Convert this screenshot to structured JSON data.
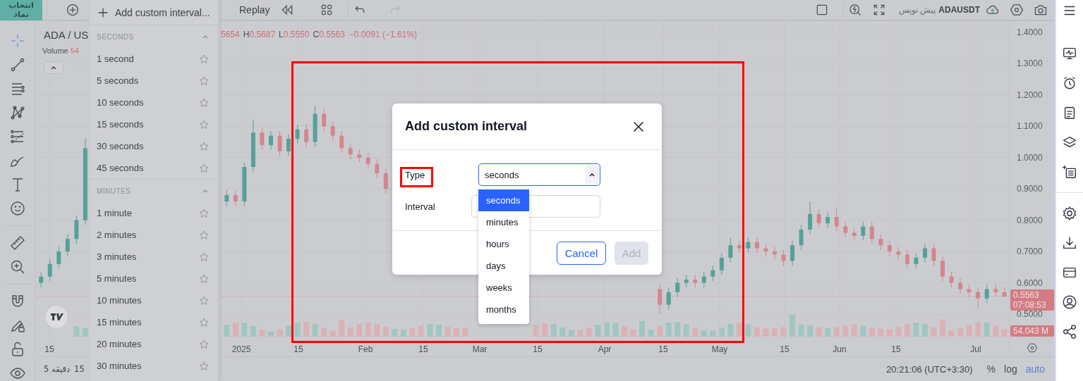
{
  "top_bar": {
    "symbol_button": "انتخاب نماد",
    "replay": "Replay",
    "symbol": "ADAUSDT",
    "draft_label": "پیش نویس"
  },
  "tools": [
    {
      "selected": true
    },
    {
      "selected": false
    },
    {
      "selected": false
    },
    {
      "selected": false
    },
    {
      "selected": false
    },
    {
      "selected": false
    },
    {
      "selected": false
    },
    {
      "selected": false
    },
    {
      "selected": false
    },
    {
      "selected": false
    },
    {
      "selected": false
    },
    {
      "selected": false
    },
    {
      "selected": false
    },
    {
      "selected": false
    }
  ],
  "interval_menu": {
    "add_custom": "Add custom interval...",
    "sections": [
      {
        "title": "SECONDS",
        "expanded": true,
        "items": [
          {
            "label": "1 second",
            "favorite": false
          },
          {
            "label": "5 seconds",
            "favorite": false
          },
          {
            "label": "10 seconds",
            "favorite": false
          },
          {
            "label": "15 seconds",
            "favorite": false
          },
          {
            "label": "30 seconds",
            "favorite": false
          },
          {
            "label": "45 seconds",
            "favorite": false
          }
        ]
      },
      {
        "title": "MINUTES",
        "expanded": true,
        "items": [
          {
            "label": "1 minute",
            "favorite": false
          },
          {
            "label": "2 minutes",
            "favorite": false
          },
          {
            "label": "3 minutes",
            "favorite": false
          },
          {
            "label": "5 minutes",
            "favorite": false
          },
          {
            "label": "10 minutes",
            "favorite": false
          },
          {
            "label": "15 minutes",
            "favorite": false
          },
          {
            "label": "20 minutes",
            "favorite": false
          },
          {
            "label": "30 minutes",
            "favorite": false
          }
        ]
      }
    ]
  },
  "chart": {
    "chart_data": {
      "type": "candlestick",
      "ylim": [
        0.419,
        1.436
      ],
      "grid": true,
      "yticks": [
        {
          "value": 1.4,
          "label": "1.4000"
        },
        {
          "value": 1.3,
          "label": "1.3000"
        },
        {
          "value": 1.2,
          "label": "1.2000"
        },
        {
          "value": 1.1,
          "label": "1.1000"
        },
        {
          "value": 1.0,
          "label": "1.0000"
        },
        {
          "value": 0.9,
          "label": "0.9000"
        },
        {
          "value": 0.8,
          "label": "0.8000"
        },
        {
          "value": 0.7,
          "label": "0.7000"
        },
        {
          "value": 0.6,
          "label": "0.6000"
        },
        {
          "value": 0.5,
          "label": "0.5000"
        }
      ],
      "categories": [
        null,
        null,
        null,
        null,
        null,
        null,
        null,
        null,
        null,
        null,
        null,
        null,
        null,
        null,
        null,
        null,
        null,
        null,
        null,
        null,
        null,
        null,
        null,
        null,
        null,
        null,
        null,
        null,
        null,
        null,
        null,
        null,
        null,
        null,
        null,
        null,
        null,
        null,
        null,
        null,
        null,
        null,
        null,
        null,
        null,
        null,
        null,
        null,
        null,
        null,
        null,
        null,
        null,
        null,
        null,
        null,
        null,
        null,
        null,
        null,
        null,
        null,
        null,
        null,
        null,
        null,
        null,
        null,
        null,
        null,
        null,
        null,
        null,
        null,
        null,
        null,
        null,
        null,
        null,
        null,
        null,
        null,
        null,
        null,
        null,
        null,
        null,
        null,
        null,
        null,
        null,
        null,
        null,
        null,
        null,
        null,
        null,
        null,
        null,
        null,
        null,
        null,
        null,
        null,
        null,
        null,
        null,
        null,
        null,
        null
      ],
      "ohlc": [
        [
          0.6,
          0.635,
          0.585,
          0.62
        ],
        [
          0.62,
          0.675,
          0.605,
          0.66
        ],
        [
          0.66,
          0.715,
          0.645,
          0.7
        ],
        [
          0.7,
          0.755,
          0.685,
          0.74
        ],
        [
          0.74,
          0.815,
          0.725,
          0.8
        ],
        [
          0.8,
          1.06,
          0.785,
          1.03
        ],
        null,
        null,
        null,
        null,
        null,
        null,
        null,
        null,
        null,
        null,
        null,
        null,
        null,
        null,
        null,
        [
          0.86,
          0.895,
          0.845,
          0.88
        ],
        [
          0.88,
          0.895,
          0.845,
          0.86
        ],
        [
          0.86,
          0.985,
          0.845,
          0.97
        ],
        [
          0.97,
          1.12,
          0.955,
          1.08
        ],
        [
          1.08,
          1.095,
          1.025,
          1.04
        ],
        [
          1.04,
          1.085,
          1.025,
          1.07
        ],
        [
          1.07,
          1.085,
          1.005,
          1.02
        ],
        [
          1.02,
          1.075,
          1.005,
          1.06
        ],
        [
          1.06,
          1.105,
          1.045,
          1.09
        ],
        [
          1.09,
          1.105,
          1.035,
          1.05
        ],
        [
          1.05,
          1.165,
          1.035,
          1.14
        ],
        [
          1.14,
          1.155,
          1.085,
          1.1
        ],
        [
          1.1,
          1.115,
          1.055,
          1.07
        ],
        [
          1.07,
          1.085,
          1.015,
          1.03
        ],
        [
          1.03,
          1.045,
          0.995,
          1.01
        ],
        [
          1.01,
          1.025,
          0.985,
          1.0
        ],
        [
          1.0,
          1.015,
          0.965,
          0.98
        ],
        [
          0.98,
          0.995,
          0.935,
          0.95
        ],
        [
          0.95,
          0.965,
          0.885,
          0.9
        ],
        null,
        null,
        null,
        null,
        null,
        null,
        null,
        null,
        null,
        null,
        null,
        null,
        null,
        null,
        null,
        null,
        null,
        null,
        null,
        null,
        null,
        null,
        null,
        null,
        null,
        null,
        null,
        null,
        null,
        null,
        [
          0.58,
          0.595,
          0.5,
          0.53
        ],
        [
          0.53,
          0.585,
          0.515,
          0.57
        ],
        [
          0.57,
          0.615,
          0.555,
          0.6
        ],
        [
          0.6,
          0.625,
          0.585,
          0.61
        ],
        [
          0.61,
          0.625,
          0.585,
          0.6
        ],
        [
          0.6,
          0.635,
          0.585,
          0.62
        ],
        [
          0.62,
          0.655,
          0.605,
          0.64
        ],
        [
          0.64,
          0.695,
          0.625,
          0.68
        ],
        [
          0.68,
          0.745,
          0.665,
          0.72
        ],
        [
          0.72,
          0.735,
          0.695,
          0.71
        ],
        [
          0.71,
          0.745,
          0.695,
          0.73
        ],
        [
          0.73,
          0.745,
          0.695,
          0.71
        ],
        [
          0.71,
          0.725,
          0.685,
          0.7
        ],
        [
          0.7,
          0.715,
          0.675,
          0.69
        ],
        [
          0.69,
          0.705,
          0.655,
          0.67
        ],
        [
          0.67,
          0.735,
          0.655,
          0.72
        ],
        [
          0.72,
          0.785,
          0.705,
          0.77
        ],
        [
          0.77,
          0.86,
          0.755,
          0.82
        ],
        [
          0.82,
          0.835,
          0.775,
          0.79
        ],
        [
          0.79,
          0.825,
          0.775,
          0.81
        ],
        [
          0.81,
          0.84,
          0.765,
          0.78
        ],
        [
          0.78,
          0.795,
          0.745,
          0.76
        ],
        [
          0.76,
          0.775,
          0.735,
          0.75
        ],
        [
          0.75,
          0.795,
          0.735,
          0.78
        ],
        [
          0.78,
          0.795,
          0.725,
          0.74
        ],
        [
          0.74,
          0.755,
          0.705,
          0.72
        ],
        [
          0.72,
          0.735,
          0.685,
          0.7
        ],
        [
          0.7,
          0.715,
          0.675,
          0.69
        ],
        [
          0.69,
          0.705,
          0.645,
          0.66
        ],
        [
          0.66,
          0.695,
          0.645,
          0.68
        ],
        [
          0.68,
          0.725,
          0.665,
          0.71
        ],
        [
          0.71,
          0.725,
          0.655,
          0.67
        ],
        [
          0.67,
          0.685,
          0.605,
          0.62
        ],
        [
          0.62,
          0.635,
          0.585,
          0.6
        ],
        [
          0.6,
          0.615,
          0.565,
          0.58
        ],
        [
          0.58,
          0.595,
          0.555,
          0.57
        ],
        [
          0.57,
          0.585,
          0.52,
          0.55
        ],
        [
          0.55,
          0.595,
          0.535,
          0.58
        ],
        [
          0.58,
          0.595,
          0.555,
          0.57
        ],
        [
          0.57,
          0.585,
          0.555,
          0.5563
        ]
      ]
    }
  },
  "legend": {
    "symbol": "ADA / US",
    "volume_label": "Volume",
    "volume_value": "54",
    "open_partial": "5654",
    "values": [
      {
        "label": "H",
        "value": "0.5687"
      },
      {
        "label": "L",
        "value": "0.5550"
      },
      {
        "label": "C",
        "value": "0.5563"
      }
    ],
    "change": "−0.0091 (−1.61%)"
  },
  "price_axis": {
    "last_price": "0.5563",
    "countdown": "07:08:53",
    "volume_tag": "54.043 M"
  },
  "time_axis": [
    "15",
    "2025",
    "15",
    "Feb",
    "15",
    "Mar",
    "15",
    "Apr",
    "15",
    "May",
    "15",
    "Jun",
    "15",
    "Jul"
  ],
  "bottom_bar": {
    "intervals": [
      "5 دقیقه",
      "15"
    ],
    "clock": "20:21:06 (UTC+3:30)",
    "scale_modes": [
      {
        "label": "%",
        "selected": false
      },
      {
        "label": "log",
        "selected": false
      },
      {
        "label": "auto",
        "selected": true
      }
    ]
  },
  "dialog": {
    "title": "Add custom interval",
    "type_label": "Type",
    "type_value": "seconds",
    "interval_label": "Interval",
    "options": [
      {
        "label": "seconds",
        "selected": true
      },
      {
        "label": "minutes",
        "selected": false
      },
      {
        "label": "hours",
        "selected": false
      },
      {
        "label": "days",
        "selected": false
      },
      {
        "label": "weeks",
        "selected": false
      },
      {
        "label": "months",
        "selected": false
      }
    ],
    "cancel": "Cancel",
    "add": "Add",
    "add_disabled": true
  }
}
